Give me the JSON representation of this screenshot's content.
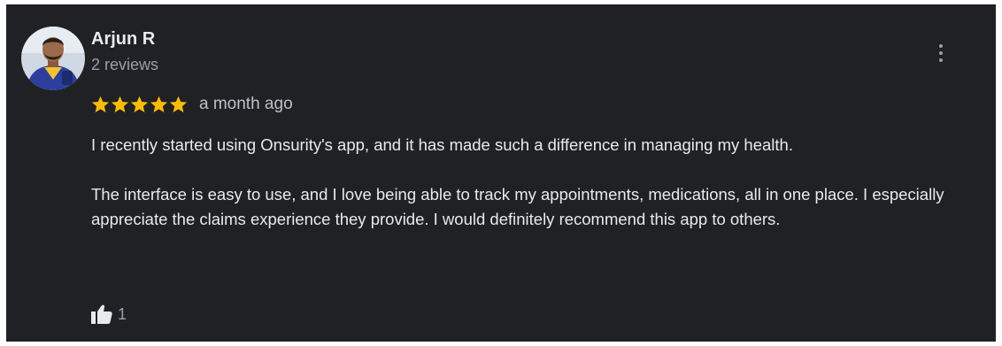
{
  "review": {
    "author": {
      "name": "Arjun R",
      "reviews_count": "2 reviews"
    },
    "rating": 5,
    "rating_color": "#fbbc04",
    "date": "a month ago",
    "paragraphs": [
      "I recently started using Onsurity's app, and it has made such a difference in managing my health.",
      "The interface is easy to use, and I love being able to track my appointments, medications, all in one place. I especially appreciate the claims experience they provide. I would definitely recommend this app to others."
    ],
    "likes": "1"
  },
  "icons": {
    "more": "more-vert-icon",
    "like": "thumbs-up-icon",
    "star": "star-icon"
  },
  "colors": {
    "card_background": "#202124",
    "primary_text": "#e8eaed",
    "secondary_text": "#9aa0a6"
  }
}
